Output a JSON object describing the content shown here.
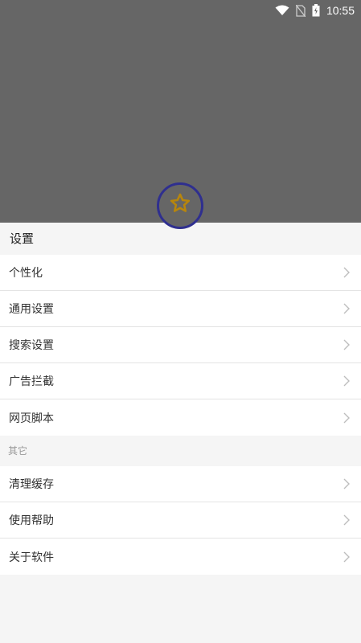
{
  "status_bar": {
    "time": "10:55",
    "icons": [
      "wifi-icon",
      "no-sim-icon",
      "battery-icon"
    ]
  },
  "fab": {
    "icon": "star-icon",
    "color": "#b8860b",
    "ring_color": "#2f2f8f"
  },
  "settings": {
    "title": "设置",
    "items": [
      {
        "label": "个性化"
      },
      {
        "label": "通用设置"
      },
      {
        "label": "搜索设置"
      },
      {
        "label": "广告拦截"
      },
      {
        "label": "网页脚本"
      }
    ]
  },
  "other": {
    "title": "其它",
    "items": [
      {
        "label": "清理缓存"
      },
      {
        "label": "使用帮助"
      },
      {
        "label": "关于软件"
      }
    ]
  }
}
